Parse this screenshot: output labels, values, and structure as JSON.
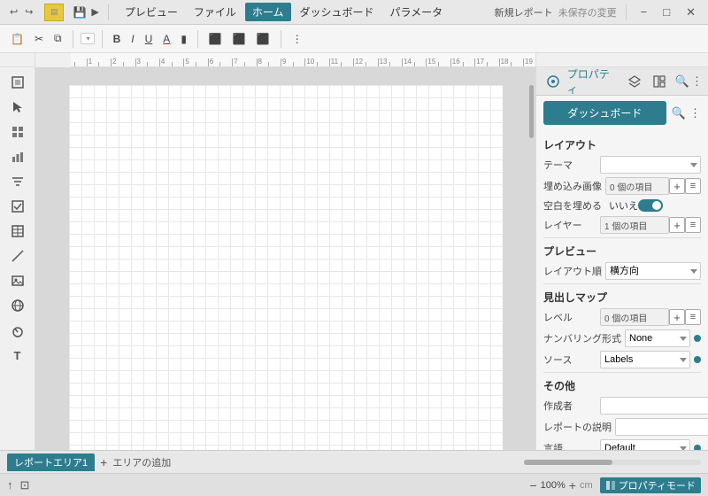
{
  "app": {
    "title": "新規レポート",
    "unsaved": "未保存の変更"
  },
  "topmenu": {
    "undo_icon": "↩",
    "redo_icon": "↪",
    "save_icon": "💾",
    "arrow_icon": "▶",
    "menu_items": [
      {
        "label": "プレビュー",
        "active": false
      },
      {
        "label": "ファイル",
        "active": false
      },
      {
        "label": "ホーム",
        "active": true
      },
      {
        "label": "ダッシュボード",
        "active": false
      },
      {
        "label": "パラメータ",
        "active": false
      }
    ],
    "new_report": "新規レポート",
    "unsaved": "未保存の変更",
    "win_min": "−",
    "win_max": "□",
    "win_close": "✕"
  },
  "toolbar": {
    "paste_icon": "📋",
    "cut_icon": "✂",
    "copy_icon": "⧉",
    "dropdown_font": "",
    "dropdown_arrow": "▾",
    "bold": "B",
    "italic": "I",
    "underline": "U",
    "font_color": "A",
    "highlight": "▮",
    "align_left": "≡",
    "align_center": "☰",
    "align_right": "≡",
    "more_icon": "⋮"
  },
  "left_sidebar": {
    "icons": [
      {
        "name": "select-tool",
        "symbol": "⊹",
        "active": false
      },
      {
        "name": "pointer-tool",
        "symbol": "↖",
        "active": false
      },
      {
        "name": "data-tool",
        "symbol": "⊞",
        "active": false
      },
      {
        "name": "chart-tool",
        "symbol": "📊",
        "active": false
      },
      {
        "name": "filter-tool",
        "symbol": "☰",
        "active": false
      },
      {
        "name": "checkbox-tool",
        "symbol": "☑",
        "active": false
      },
      {
        "name": "table-tool",
        "symbol": "⊟",
        "active": false
      },
      {
        "name": "line-tool",
        "symbol": "╱",
        "active": false
      },
      {
        "name": "image-tool",
        "symbol": "🖼",
        "active": false
      },
      {
        "name": "map-tool",
        "symbol": "🗺",
        "active": false
      },
      {
        "name": "gauge-tool",
        "symbol": "⊙",
        "active": false
      },
      {
        "name": "text-tool",
        "symbol": "T",
        "active": false
      }
    ]
  },
  "right_panel": {
    "props_icon": "⚙",
    "props_label": "プロパティ",
    "layers_icon": "⊕",
    "layout_icon": "▦",
    "search_icon": "🔍",
    "more_icon": "⋮",
    "dashboard_btn": "ダッシュボード",
    "layout_section": "レイアウト",
    "theme_label": "テーマ",
    "embed_label": "埋め込み画像",
    "embed_value": "0 個の項目",
    "fill_label": "空白を埋める",
    "fill_value": "いいえ",
    "layer_label": "レイヤー",
    "layer_value": "1 個の項目",
    "preview_section": "プレビュー",
    "layout_dir_label": "レイアウト順",
    "layout_dir_value": "横方向",
    "headmap_section": "見出しマップ",
    "level_label": "レベル",
    "level_value": "0 個の項目",
    "numbering_label": "ナンバリング形式",
    "numbering_value": "None",
    "source_label": "ソース",
    "source_value": "Labels",
    "other_section": "その他",
    "author_label": "作成者",
    "desc_label": "レポートの説明",
    "lang_label": "言語",
    "lang_value": "Default",
    "add_icon": "+",
    "menu_icon": "≡"
  },
  "bottom_bar": {
    "tab1": "レポートエリア1",
    "add_icon": "+",
    "add_label": "エリアの追加"
  },
  "status_bar": {
    "cursor_icon": "↑",
    "frame_icon": "⊡",
    "zoom_minus": "−",
    "zoom_level": "100%",
    "zoom_plus": "+",
    "unit": "cm",
    "prop_mode": "プロパティモード",
    "x_label": "+",
    "cm_label": "cm"
  }
}
